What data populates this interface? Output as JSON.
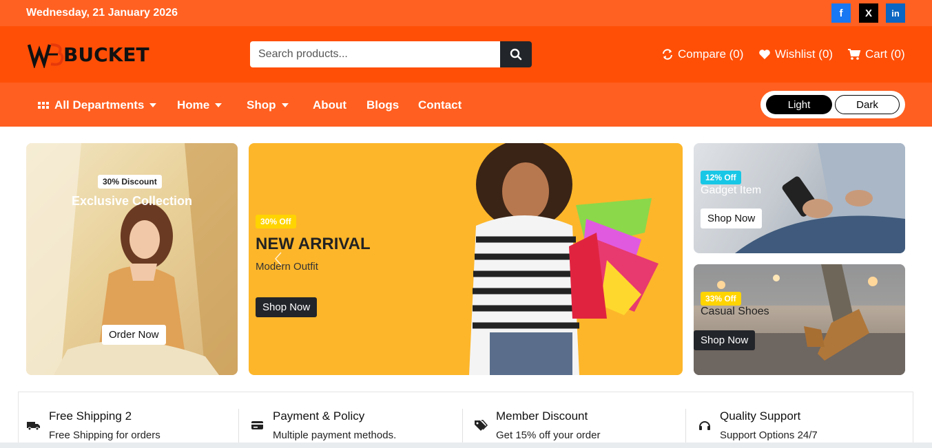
{
  "topbar": {
    "date": "Wednesday, 21 January 2026",
    "social": [
      {
        "name": "facebook-icon",
        "glyph": "f",
        "color": "#1877f2"
      },
      {
        "name": "x-icon",
        "glyph": "X",
        "color": "#000000"
      },
      {
        "name": "linkedin-icon",
        "glyph": "in",
        "color": "#0a66c2"
      }
    ]
  },
  "header": {
    "logo_text": "BUCKET",
    "search_placeholder": "Search products...",
    "compare_label": "Compare (0)",
    "wishlist_label": "Wishlist (0)",
    "cart_label": "Cart (0)"
  },
  "nav": {
    "all_departments": "All Departments",
    "home": "Home",
    "shop": "Shop",
    "about": "About",
    "blogs": "Blogs",
    "contact": "Contact",
    "theme_light": "Light",
    "theme_dark": "Dark"
  },
  "banners": {
    "left": {
      "badge": "30% Discount",
      "title": "Exclusive Collection",
      "button": "Order Now"
    },
    "main": {
      "badge": "30% Off",
      "title": "NEW ARRIVAL",
      "subtitle": "Modern Outfit",
      "button": "Shop Now"
    },
    "right_top": {
      "badge": "12% Off",
      "title": "Gadget Item",
      "button": "Shop Now"
    },
    "right_bottom": {
      "badge": "33% Off",
      "title": "Casual Shoes",
      "button": "Shop Now"
    }
  },
  "features": [
    {
      "title": "Free Shipping 2",
      "subtitle": "Free Shipping for orders",
      "icon": "truck-icon"
    },
    {
      "title": "Payment & Policy",
      "subtitle": "Multiple payment methods.",
      "icon": "credit-card-icon"
    },
    {
      "title": "Member Discount",
      "subtitle": "Get 15% off your order",
      "icon": "tags-icon"
    },
    {
      "title": "Quality Support",
      "subtitle": "Support Options 24/7",
      "icon": "headset-icon"
    }
  ],
  "colors": {
    "topbar": "#ff6122",
    "header": "#ff4f07",
    "nav": "#ff5f20",
    "hero_bg": "#fdb62a",
    "dark_button": "#22252a",
    "badge_yellow": "#ffd400",
    "badge_cyan": "#18c7e6"
  }
}
